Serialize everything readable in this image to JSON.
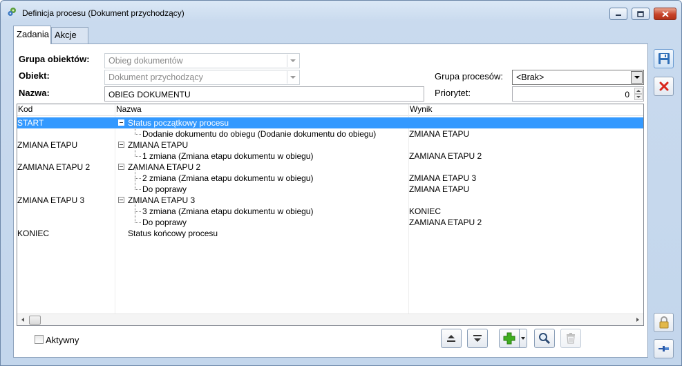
{
  "window": {
    "title": "Definicja procesu (Dokument przychodzący)",
    "controls": {
      "minimize": "minimize",
      "maximize": "maximize",
      "close": "close"
    }
  },
  "tabs": [
    {
      "label": "Zadania",
      "active": true
    },
    {
      "label": "Akcje",
      "active": false
    }
  ],
  "form": {
    "grupa_obiektow": {
      "label": "Grupa obiektów:",
      "value": "Obieg dokumentów",
      "enabled": false
    },
    "obiekt": {
      "label": "Obiekt:",
      "value": "Dokument przychodzący",
      "enabled": false
    },
    "nazwa": {
      "label": "Nazwa:",
      "value": "OBIEG DOKUMENTU"
    },
    "grupa_procesow": {
      "label": "Grupa procesów:",
      "value": "<Brak>",
      "enabled": true
    },
    "priorytet": {
      "label": "Priorytet:",
      "value": "0"
    }
  },
  "grid": {
    "columns": [
      "Kod",
      "Nazwa",
      "Wynik"
    ],
    "rows": [
      {
        "kod": "START",
        "nazwa": "Status początkowy procesu",
        "wynik": "",
        "level": 0,
        "expander": true,
        "selected": true
      },
      {
        "kod": "",
        "nazwa": "Dodanie dokumentu do obiegu (Dodanie dokumentu do obiegu)",
        "wynik": "ZMIANA ETAPU",
        "level": 1,
        "expander": false,
        "selected": false
      },
      {
        "kod": "ZMIANA ETAPU",
        "nazwa": "ZMIANA ETAPU",
        "wynik": "",
        "level": 0,
        "expander": true,
        "selected": false
      },
      {
        "kod": "",
        "nazwa": "1 zmiana (Zmiana etapu dokumentu w obiegu)",
        "wynik": "ZAMIANA ETAPU 2",
        "level": 1,
        "expander": false,
        "selected": false
      },
      {
        "kod": "ZAMIANA ETAPU 2",
        "nazwa": "ZAMIANA ETAPU 2",
        "wynik": "",
        "level": 0,
        "expander": true,
        "selected": false
      },
      {
        "kod": "",
        "nazwa": "2 zmiana (Zmiana etapu dokumentu w obiegu)",
        "wynik": "ZMIANA ETAPU 3",
        "level": 1,
        "expander": false,
        "selected": false
      },
      {
        "kod": "",
        "nazwa": "Do poprawy",
        "wynik": "ZMIANA ETAPU",
        "level": 1,
        "expander": false,
        "selected": false
      },
      {
        "kod": "ZMIANA ETAPU 3",
        "nazwa": "ZMIANA ETAPU 3",
        "wynik": "",
        "level": 0,
        "expander": true,
        "selected": false
      },
      {
        "kod": "",
        "nazwa": "3 zmiana (Zmiana etapu dokumentu w obiegu)",
        "wynik": "KONIEC",
        "level": 1,
        "expander": false,
        "selected": false
      },
      {
        "kod": "",
        "nazwa": "Do poprawy",
        "wynik": "ZAMIANA ETAPU 2",
        "level": 1,
        "expander": false,
        "selected": false
      },
      {
        "kod": "KONIEC",
        "nazwa": "Status końcowy procesu",
        "wynik": "",
        "level": 0,
        "expander": false,
        "selected": false
      }
    ]
  },
  "footer": {
    "aktywny": {
      "label": "Aktywny",
      "checked": false
    },
    "buttons": [
      "move-up",
      "move-down",
      "add",
      "add-dropdown",
      "preview",
      "delete"
    ]
  },
  "sidebar": [
    "save",
    "cancel",
    "lock",
    "pin"
  ],
  "colors": {
    "selection": "#3399ff",
    "add_green": "#3fae1f",
    "cancel_red": "#d9261c",
    "save_blue": "#2f6fb8"
  }
}
